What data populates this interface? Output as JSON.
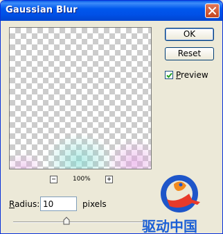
{
  "window": {
    "title": "Gaussian Blur",
    "close_icon": "close-icon"
  },
  "buttons": {
    "ok": "OK",
    "reset": "Reset"
  },
  "preview_checkbox": {
    "label": "Preview",
    "checked": true
  },
  "zoom": {
    "level": "100%",
    "zoom_out_icon": "minus-icon",
    "zoom_in_icon": "plus-icon"
  },
  "radius": {
    "label": "Radius:",
    "value": "10",
    "units": "pixels",
    "slider_fraction": 0.4
  },
  "watermark": {
    "text": "驱动中国",
    "color": "#1a5fd6"
  },
  "colors": {
    "title_bar": "#0054e3",
    "dialog_bg": "#ece9d8",
    "close_button": "#d8532e"
  }
}
